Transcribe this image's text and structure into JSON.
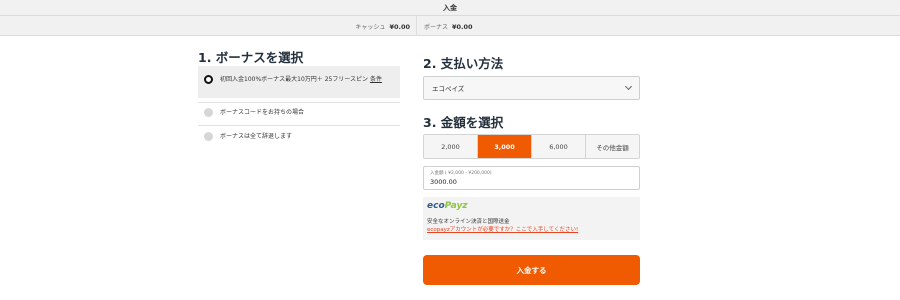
{
  "header": {
    "title": "入金",
    "cash_label": "キャッシュ",
    "cash_value": "¥0.00",
    "bonus_label": "ボーナス",
    "bonus_value": "¥0.00"
  },
  "bonus_section": {
    "heading": "1. ボーナスを選択",
    "options": [
      {
        "text": "初回入金100%ボーナス最大10万円＋ 25フリースピン",
        "link": "条件",
        "selected": true
      },
      {
        "text": "ボーナスコードをお持ちの場合",
        "selected": false
      },
      {
        "text": "ボーナスは全て辞退します",
        "selected": false
      }
    ]
  },
  "payment_section": {
    "heading": "2. 支払い方法",
    "selected_method": "エコペイズ"
  },
  "amount_section": {
    "heading": "3. 金額を選択",
    "amounts": [
      "2,000",
      "3,000",
      "6,000",
      "その他金額"
    ],
    "selected_index": 1,
    "input_label": "入金額 ( ¥2,000 - ¥200,000)",
    "input_value": "3000.00"
  },
  "info": {
    "logo_eco": "eco",
    "logo_payz": "Payz",
    "description": "安全なオンライン決済と国際送金",
    "link_text": "ecopayzアカウントが必要ですか？ここで入手してください!"
  },
  "submit_label": "入金する",
  "colors": {
    "accent": "#f05a00",
    "heading": "#24313d"
  }
}
